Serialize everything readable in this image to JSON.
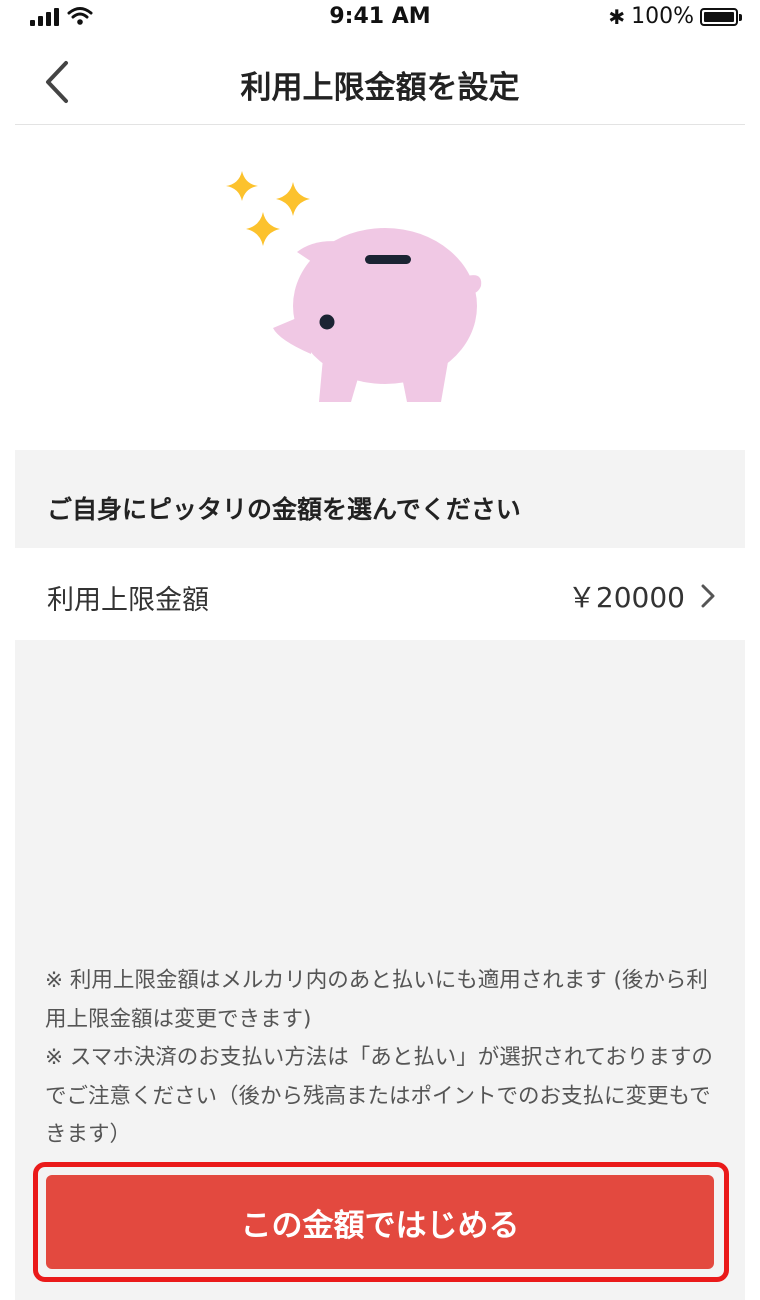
{
  "status_bar": {
    "time": "9:41 AM",
    "battery": "100%",
    "bluetooth_symbol": "✱"
  },
  "nav": {
    "title": "利用上限金額を設定",
    "back_icon": "chevron-left-icon"
  },
  "hero": {
    "illustration": "piggy-bank",
    "pig_color": "#F0C8E4",
    "sparkle_color": "#FCC22D"
  },
  "section": {
    "title": "ご自身にピッタリの金額を選んでください"
  },
  "limit_row": {
    "label": "利用上限金額",
    "value": "￥20000"
  },
  "notes": {
    "note1": "※ 利用上限金額はメルカリ内のあと払いにも適用されます (後から利用上限金額は変更できます)",
    "note2": "※ スマホ決済のお支払い方法は「あと払い」が選択されておりますのでご注意ください（後から残高またはポイントでのお支払に変更もできます）"
  },
  "cta": {
    "label": "この金額ではじめる",
    "color": "#E3493F",
    "highlight_color": "#EA1A1A"
  }
}
